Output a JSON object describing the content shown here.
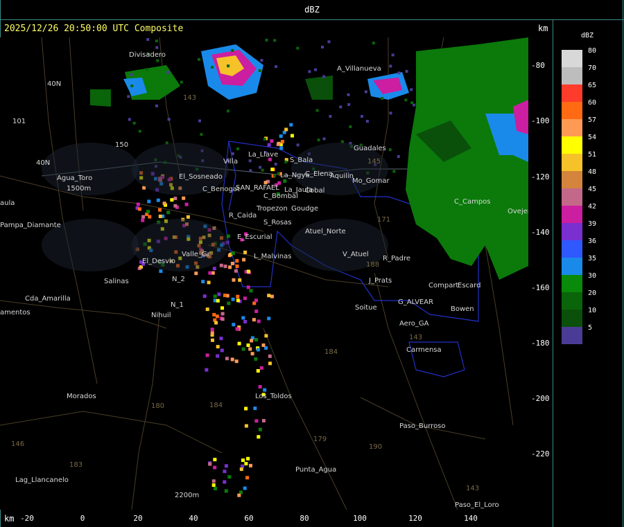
{
  "window_title": "dBZ",
  "header": "2025/12/26 20:50:00 UTC Composite",
  "km_label": "km",
  "x_ticks": [
    "-20",
    "0",
    "20",
    "40",
    "60",
    "80",
    "100",
    "120",
    "140"
  ],
  "y_ticks": [
    "-80",
    "-100",
    "-120",
    "-140",
    "-160",
    "-180",
    "-200",
    "-220"
  ],
  "legend": {
    "title": "dBZ",
    "levels": [
      "80",
      "70",
      "65",
      "60",
      "57",
      "54",
      "51",
      "48",
      "45",
      "42",
      "39",
      "36",
      "35",
      "30",
      "20",
      "10",
      "5"
    ],
    "colors": [
      "#d8d8d8",
      "#bdbdbd",
      "#ff3b2b",
      "#ff6a12",
      "#ff9a55",
      "#ffff00",
      "#f5c22a",
      "#d4843c",
      "#c4688a",
      "#cc1ea0",
      "#7a2fd0",
      "#2f58ff",
      "#1a8aea",
      "#0a8a0a",
      "#0a640a",
      "#0a500a",
      "#4a3c96"
    ]
  },
  "places": [
    {
      "name": "Divisadero"
    },
    {
      "name": "A_Villanueva"
    },
    {
      "name": "40N"
    },
    {
      "name": "101"
    },
    {
      "name": "40N"
    },
    {
      "name": "150"
    },
    {
      "name": "Agua_Toro"
    },
    {
      "name": "1500m"
    },
    {
      "name": "aula"
    },
    {
      "name": "Pampa_Diamante"
    },
    {
      "name": "Guadales"
    },
    {
      "name": "C_Campos"
    },
    {
      "name": "Ovejer"
    },
    {
      "name": "Villa"
    },
    {
      "name": "S_Bala"
    },
    {
      "name": "C_Elena"
    },
    {
      "name": "Aquilin"
    },
    {
      "name": "La_Llave"
    },
    {
      "name": "La_Ngya"
    },
    {
      "name": "El_Sosneado"
    },
    {
      "name": "Mo_Gomar"
    },
    {
      "name": "C_Benogat"
    },
    {
      "name": "SAN_RAFAEL"
    },
    {
      "name": "La_Jaula"
    },
    {
      "name": "Cobal"
    },
    {
      "name": "C_Bombal"
    },
    {
      "name": "Tropezon"
    },
    {
      "name": "Goudge"
    },
    {
      "name": "R_Caida"
    },
    {
      "name": "S_Rosas"
    },
    {
      "name": "Atuel_Norte"
    },
    {
      "name": "E_Escurial"
    },
    {
      "name": "El_Desvio"
    },
    {
      "name": "Valle_Gr"
    },
    {
      "name": "L_Malvinas"
    },
    {
      "name": "V_Atuel"
    },
    {
      "name": "R_Padre"
    },
    {
      "name": "Salinas"
    },
    {
      "name": "Cda_Amarilla"
    },
    {
      "name": "N_2"
    },
    {
      "name": "N_1"
    },
    {
      "name": "Nihuil"
    },
    {
      "name": "J_Prats"
    },
    {
      "name": "Compart"
    },
    {
      "name": "Escard"
    },
    {
      "name": "G_ALVEAR"
    },
    {
      "name": "Soitue"
    },
    {
      "name": "Bowen"
    },
    {
      "name": "amentos"
    },
    {
      "name": "Aero_GA"
    },
    {
      "name": "Carmensa"
    },
    {
      "name": "Morados"
    },
    {
      "name": "Los_Toldos"
    },
    {
      "name": "Paso_Burroso"
    },
    {
      "name": "Lag_Llancanelo"
    },
    {
      "name": "Punta_Agua"
    },
    {
      "name": "Paso_El_Loro"
    },
    {
      "name": "2200m"
    }
  ],
  "routes": [
    "143",
    "171",
    "188",
    "184",
    "180",
    "179",
    "184",
    "183",
    "190",
    "143",
    "143",
    "145",
    "146"
  ]
}
